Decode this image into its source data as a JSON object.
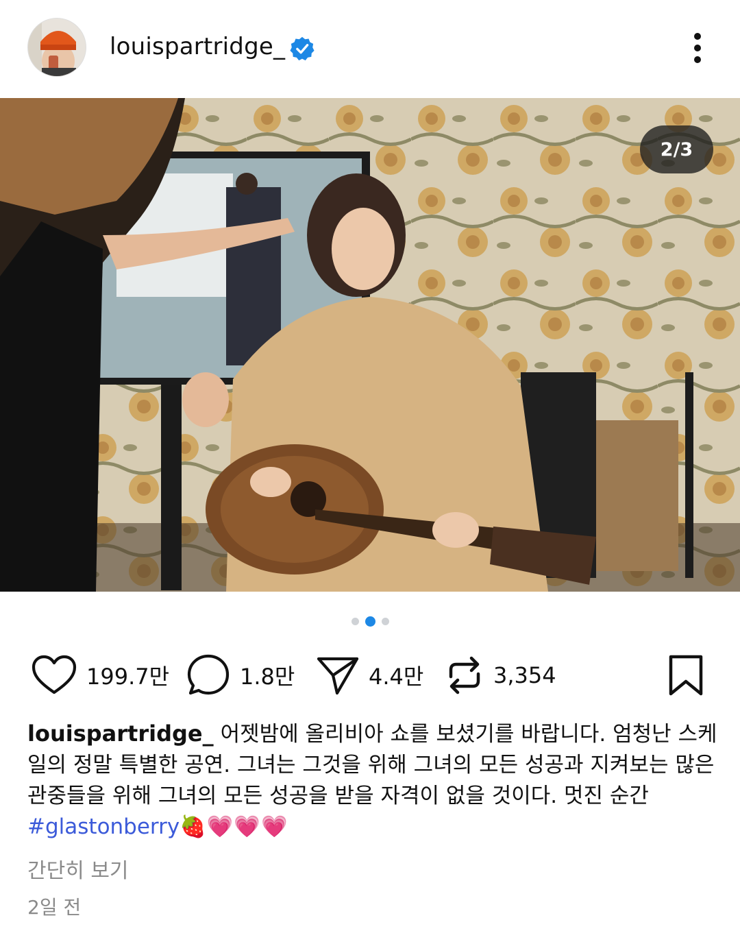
{
  "post": {
    "username": "louispartridge_",
    "verified": true,
    "slide_counter": "2/3",
    "carousel": {
      "total": 3,
      "current": 2
    }
  },
  "actions": {
    "likes": "199.7만",
    "comments": "1.8만",
    "shares": "4.4만",
    "reposts": "3,354"
  },
  "caption": {
    "username": "louispartridge_",
    "text": "어젯밤에 올리비아 쇼를 보셨기를 바랍니다. 엄청난 스케일의 정말 특별한 공연. 그녀는 그것을 위해 그녀의 모든 성공과 지켜보는 많은 관중들을 위해 그녀의 모든 성공을 받을 자격이 없을 것이다. 멋진 순간",
    "hashtag": "#glastonberry",
    "emoji": "🍓💗💗💗"
  },
  "show_less": "간단히 보기",
  "timestamp": "2일 전",
  "colors": {
    "accent": "#1d88e5",
    "hashtag": "#3b5ad9",
    "verified": "#1d88e5"
  },
  "icons": [
    "heart-icon",
    "comment-icon",
    "share-icon",
    "repost-icon",
    "bookmark-icon",
    "more-icon",
    "verified-badge-icon"
  ]
}
